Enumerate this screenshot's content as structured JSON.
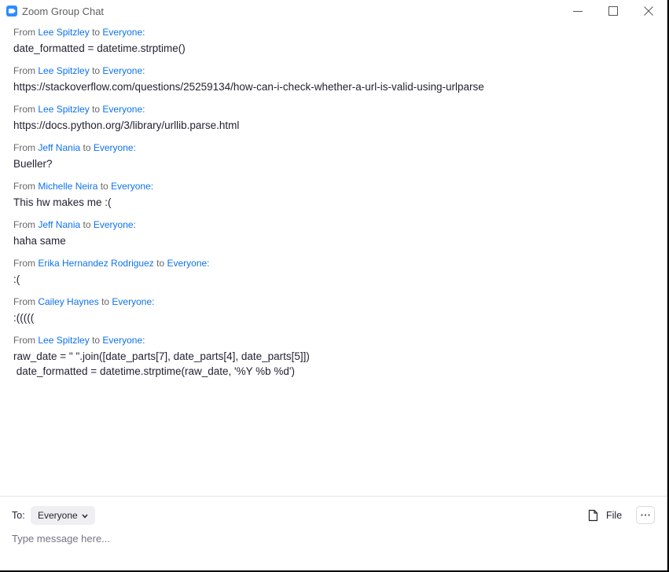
{
  "window": {
    "title": "Zoom Group Chat",
    "icon": "zoom-camera-icon",
    "accent_color": "#2d8cff",
    "controls": [
      "minimize-icon",
      "maximize-icon",
      "close-icon"
    ]
  },
  "messages": [
    {
      "from_label": "From",
      "sender": "Lee Spitzley",
      "to_label": "to",
      "recipient": "Everyone:",
      "text": "date_formatted = datetime.strptime()"
    },
    {
      "from_label": "From",
      "sender": "Lee Spitzley",
      "to_label": "to",
      "recipient": "Everyone:",
      "text": "https://stackoverflow.com/questions/25259134/how-can-i-check-whether-a-url-is-valid-using-urlparse"
    },
    {
      "from_label": "From",
      "sender": "Lee Spitzley",
      "to_label": "to",
      "recipient": "Everyone:",
      "text": "https://docs.python.org/3/library/urllib.parse.html"
    },
    {
      "from_label": "From",
      "sender": "Jeff Nania",
      "to_label": "to",
      "recipient": "Everyone:",
      "text": "Bueller?"
    },
    {
      "from_label": "From",
      "sender": "Michelle Neira",
      "to_label": "to",
      "recipient": "Everyone:",
      "text": "This hw makes me :("
    },
    {
      "from_label": "From",
      "sender": "Jeff Nania",
      "to_label": "to",
      "recipient": "Everyone:",
      "text": "haha same"
    },
    {
      "from_label": "From",
      "sender": "Erika Hernandez Rodriguez",
      "to_label": "to",
      "recipient": "Everyone:",
      "text": ":("
    },
    {
      "from_label": "From",
      "sender": "Cailey Haynes",
      "to_label": "to",
      "recipient": "Everyone:",
      "text": ":((((("
    },
    {
      "from_label": "From",
      "sender": "Lee Spitzley",
      "to_label": "to",
      "recipient": "Everyone:",
      "text": "raw_date = \" \".join([date_parts[7], date_parts[4], date_parts[5]])\n date_formatted = datetime.strptime(raw_date, '%Y %b %d')"
    }
  ],
  "composer": {
    "to_label": "To:",
    "recipient": "Everyone",
    "file_label": "File",
    "placeholder": "Type message here...",
    "value": ""
  },
  "colors": {
    "link_blue": "#0e72ed",
    "header_gray": "#666666",
    "text": "#232333"
  }
}
